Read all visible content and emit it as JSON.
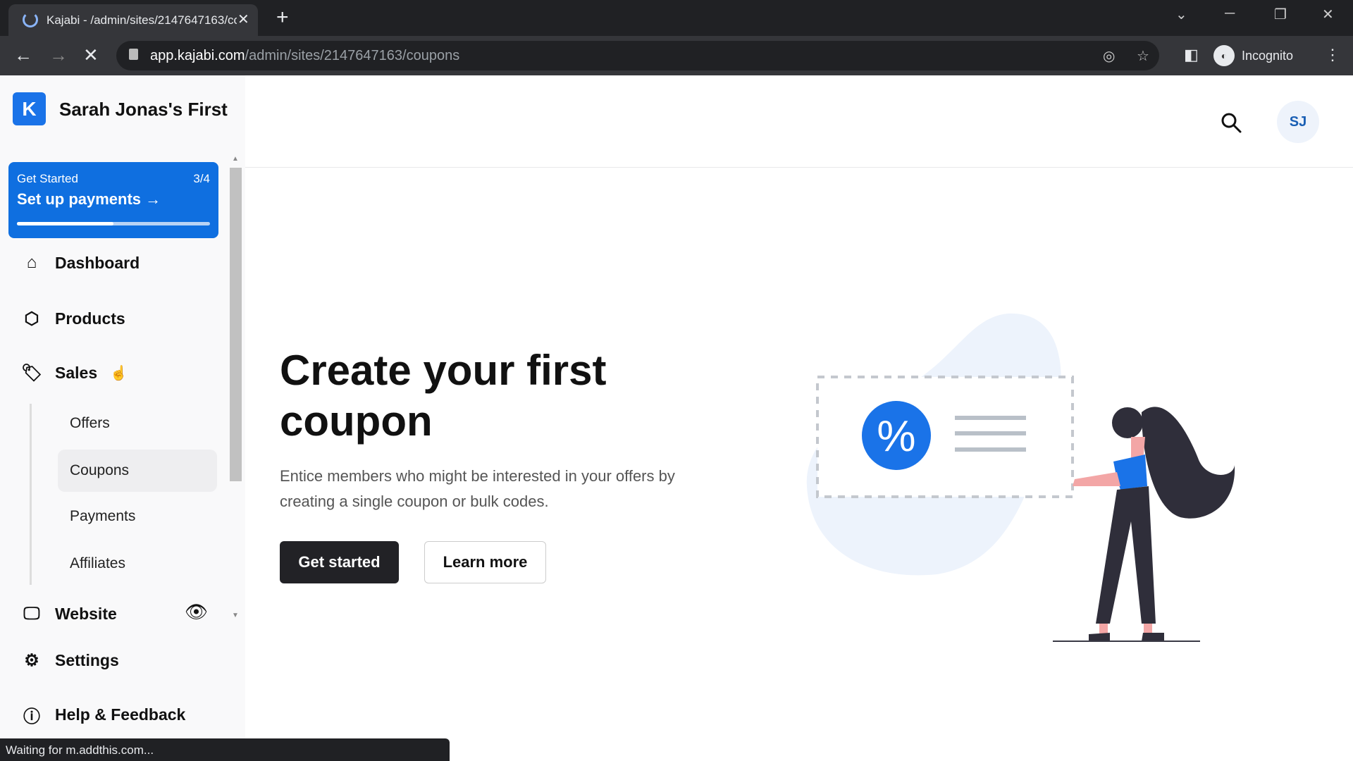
{
  "browser": {
    "tab_title": "Kajabi - /admin/sites/2147647163/coupons",
    "url_host": "app.kajabi.com",
    "url_path": "/admin/sites/2147647163/coupons",
    "profile_label": "Incognito",
    "status_text": "Waiting for m.addthis.com..."
  },
  "sidebar": {
    "site_name": "Sarah Jonas's First",
    "logo_letter": "K",
    "get_started": {
      "label": "Get Started",
      "progress_text": "3/4",
      "progress": 0.5,
      "action": "Set up payments",
      "arrow": "→"
    },
    "items": [
      {
        "label": "Dashboard",
        "icon": "home-icon"
      },
      {
        "label": "Products",
        "icon": "box-icon"
      },
      {
        "label": "Sales",
        "icon": "tag-icon"
      },
      {
        "label": "Website",
        "icon": "monitor-icon"
      },
      {
        "label": "Settings",
        "icon": "gear-icon"
      },
      {
        "label": "Help & Feedback",
        "icon": "help-icon"
      }
    ],
    "sales_sub": [
      {
        "label": "Offers"
      },
      {
        "label": "Coupons",
        "active": true
      },
      {
        "label": "Payments"
      },
      {
        "label": "Affiliates"
      }
    ]
  },
  "header": {
    "avatar_initials": "SJ"
  },
  "main": {
    "title": "Create your first coupon",
    "description": "Entice members who might be interested in your offers by creating a single coupon or bulk codes.",
    "primary_button": "Get started",
    "secondary_button": "Learn more",
    "illustration_symbol": "%"
  },
  "colors": {
    "accent": "#1a73e8",
    "primary_button": "#222226"
  }
}
